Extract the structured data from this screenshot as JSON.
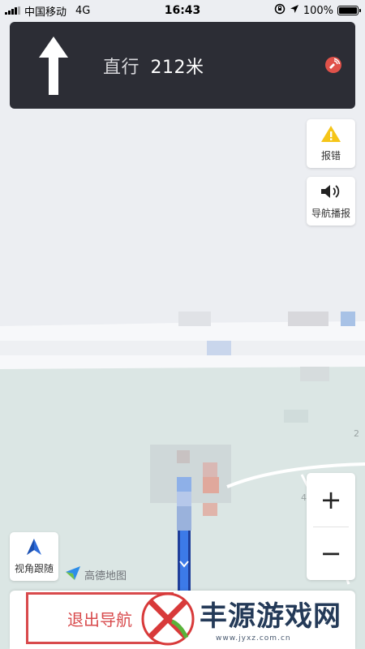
{
  "status_bar": {
    "carrier": "中国移动",
    "network": "4G",
    "time": "16:43",
    "battery": "100%",
    "battery_level": 1.0
  },
  "navigation": {
    "action": "直行",
    "distance": "212米"
  },
  "side_buttons": {
    "report_label": "报错",
    "voice_label": "导航播报"
  },
  "zoom": {
    "in_label": "+",
    "out_label": "−"
  },
  "follow_label": "视角跟随",
  "brand_label": "高德地图",
  "exit_label": "退出导航",
  "watermark": {
    "text": "丰源游戏网",
    "url": "www.jyxz.com.cn"
  },
  "colors": {
    "banner_bg": "#2c2d35",
    "exit_red": "#d84a4c",
    "route_blue": "#2d6bd8",
    "warning_yellow": "#f5c518",
    "gps_red": "#e0524a"
  },
  "icons": {
    "direction": "arrow-up-icon",
    "gps": "gps-signal-icon",
    "report": "warning-icon",
    "voice": "speaker-icon",
    "follow": "compass-arrow-icon",
    "brand": "amap-logo-icon"
  }
}
